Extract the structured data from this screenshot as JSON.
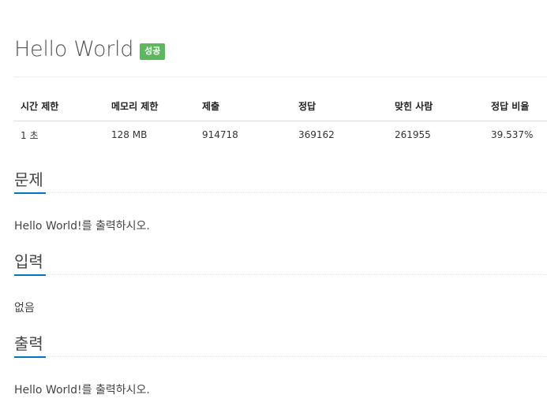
{
  "problem": {
    "title": "Hello World",
    "badge": "성공",
    "badge_color": "#5cb85c",
    "accent_color": "#0076c0"
  },
  "info_table": {
    "headers": [
      "시간 제한",
      "메모리 제한",
      "제출",
      "정답",
      "맞힌 사람",
      "정답 비율"
    ],
    "values": [
      "1 초",
      "128 MB",
      "914718",
      "369162",
      "261955",
      "39.537%"
    ]
  },
  "sections": [
    {
      "title": "문제",
      "text": "Hello World!를 출력하시오."
    },
    {
      "title": "입력",
      "text": "없음"
    },
    {
      "title": "출력",
      "text": "Hello World!를 출력하시오."
    }
  ]
}
